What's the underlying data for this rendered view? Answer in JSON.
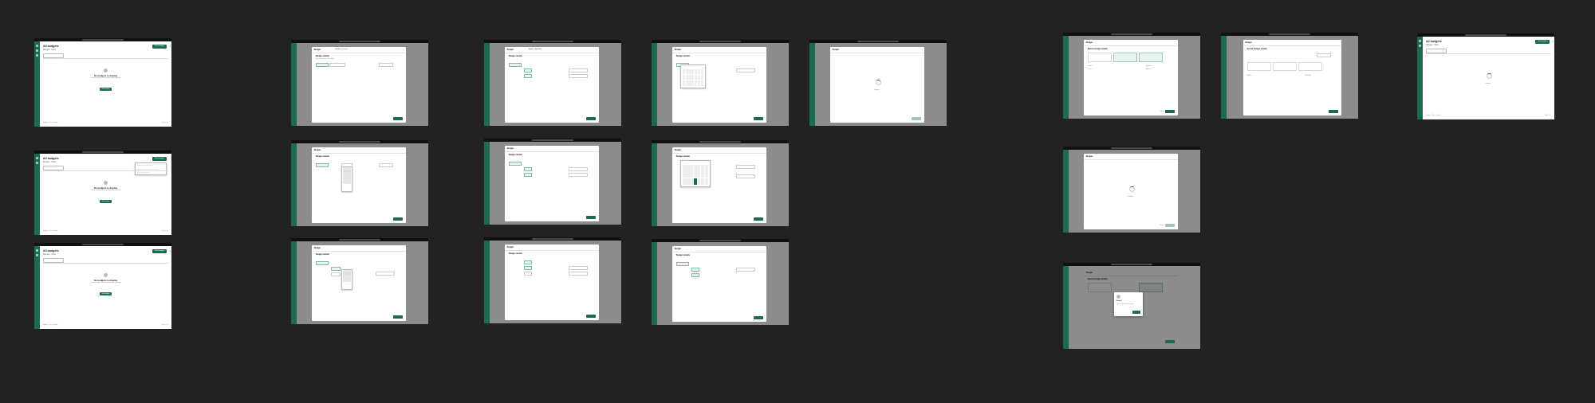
{
  "app": {
    "page_title": "All budgets",
    "page_subtitle": "Budgets · Plans",
    "new_button": "New budget",
    "close_glyph": "×",
    "empty_title": "No budgets to display",
    "empty_text": "Create a budget to start tracking your spending",
    "empty_button": "New budget",
    "footer_left": "Budgets · Plans · Settings",
    "footer_right": "Page 1 of 1"
  },
  "wizard": {
    "title": "Budget",
    "steps": [
      "Details",
      "Schedule",
      "Review"
    ],
    "section_title": "Budget details",
    "section_subtitle": "Enter the details for this budget",
    "cancel": "Cancel",
    "loading": "Loading…"
  },
  "summary": {
    "title": "Spend budget details",
    "labels": [
      "Details",
      "Schedule",
      "Owner",
      "Amount"
    ],
    "confirm_title": "Delete?",
    "confirm_text": "This action can't be undone"
  },
  "colors": {
    "accent": "#1d6b4e",
    "background": "#222222",
    "panel": "#ffffff"
  },
  "icons": [
    "close-icon",
    "spinner-icon",
    "calendar-icon",
    "chevron-down-icon"
  ]
}
